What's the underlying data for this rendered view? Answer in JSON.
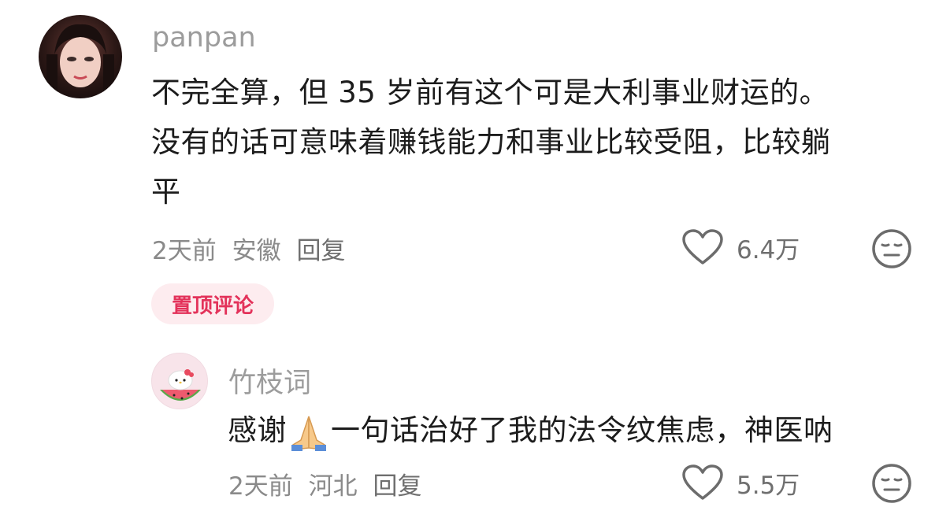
{
  "comment": {
    "username": "panpan",
    "text_line1": "不完全算，但 35 岁前有这个可是大利事业财运的。",
    "text_line2": "没有的话可意味着赚钱能力和事业比较受阻，比较躺",
    "text_line3": "平",
    "time": "2天前",
    "location": "安徽",
    "reply_label": "回复",
    "likes": "6.4万",
    "pinned_label": "置顶评论"
  },
  "reply": {
    "username": "竹枝词",
    "text_before_emoji": "感谢",
    "emoji_name": "folded-hands-icon",
    "text_after_emoji": "一句话治好了我的法令纹焦虑，神医呐",
    "time": "2天前",
    "location": "河北",
    "reply_label": "回复",
    "likes": "5.5万"
  },
  "colors": {
    "username": "#9c9c9c",
    "text": "#1c1c1c",
    "meta": "#8a8a8a",
    "pinned_bg": "#fdecef",
    "pinned_fg": "#e3325a"
  }
}
